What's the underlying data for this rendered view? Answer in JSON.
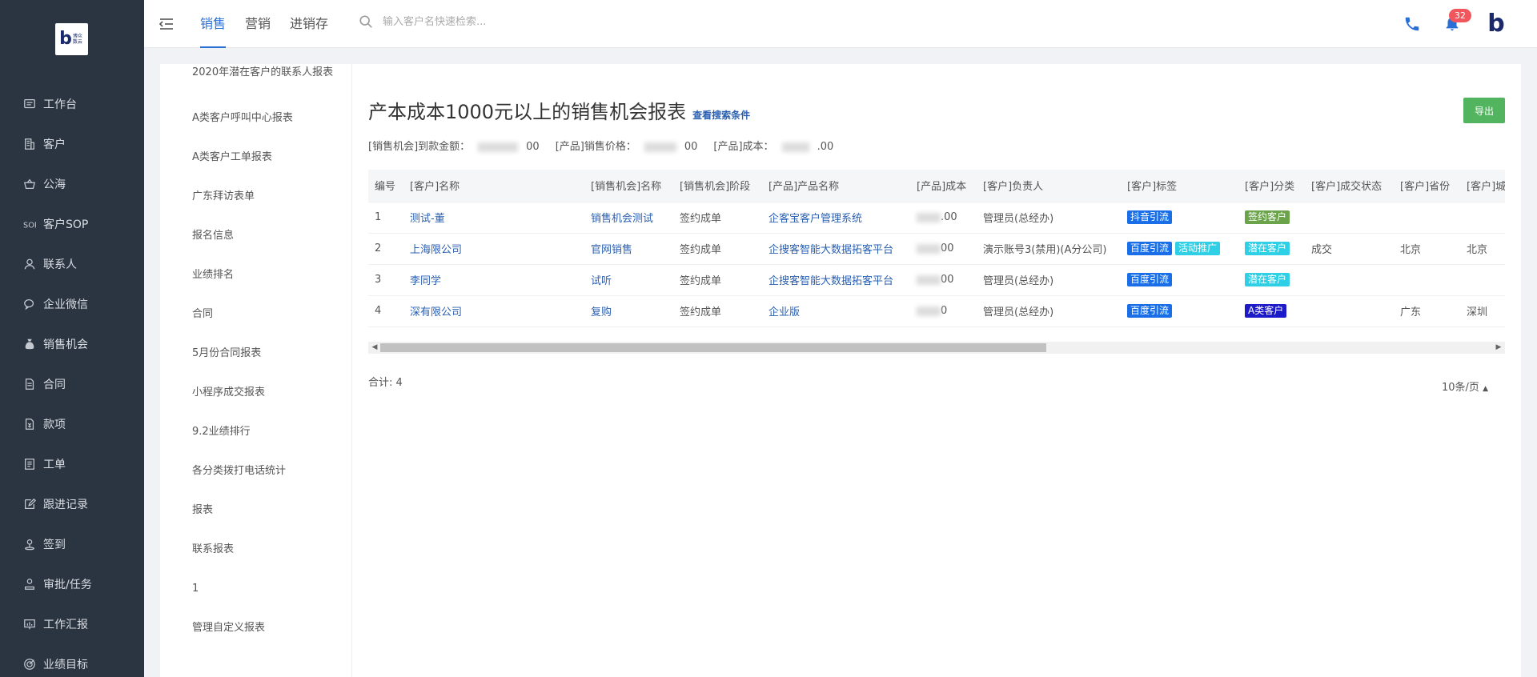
{
  "logo": {
    "text": "博众数云"
  },
  "sidebar": {
    "items": [
      {
        "label": "工作台",
        "icon": "dashboard-icon"
      },
      {
        "label": "客户",
        "icon": "building-icon"
      },
      {
        "label": "公海",
        "icon": "basket-icon"
      },
      {
        "label": "客户SOP",
        "icon": "sop-icon"
      },
      {
        "label": "联系人",
        "icon": "person-icon"
      },
      {
        "label": "企业微信",
        "icon": "wechat-icon"
      },
      {
        "label": "销售机会",
        "icon": "moneybag-icon"
      },
      {
        "label": "合同",
        "icon": "contract-icon"
      },
      {
        "label": "款项",
        "icon": "payment-icon"
      },
      {
        "label": "工单",
        "icon": "ticket-icon"
      },
      {
        "label": "跟进记录",
        "icon": "edit-icon"
      },
      {
        "label": "签到",
        "icon": "location-icon"
      },
      {
        "label": "审批/任务",
        "icon": "approval-icon"
      },
      {
        "label": "工作汇报",
        "icon": "report-icon"
      },
      {
        "label": "业绩目标",
        "icon": "target-icon"
      }
    ]
  },
  "topbar": {
    "tabs": [
      {
        "label": "销售",
        "active": true
      },
      {
        "label": "营销",
        "active": false
      },
      {
        "label": "进销存",
        "active": false
      }
    ],
    "search_placeholder": "输入客户名快速检索...",
    "notification_count": "32"
  },
  "reports": {
    "first": "2020年潜在客户的联系人报表",
    "items": [
      "A类客户呼叫中心报表",
      "A类客户工单报表",
      "广东拜访表单",
      "报名信息",
      "业绩排名",
      "合同",
      "5月份合同报表",
      "小程序成交报表",
      "9.2业绩排行",
      "各分类拨打电话统计",
      "报表",
      "联系报表",
      "1",
      "管理自定义报表"
    ]
  },
  "main": {
    "title": "产本成本1000元以上的销售机会报表",
    "sublink": "查看搜索条件",
    "export_label": "导出",
    "summary": {
      "amount_label": "[销售机会]到款金额：",
      "amount_tail": "00",
      "price_label": "[产品]销售价格：",
      "price_tail": "00",
      "cost_label": "[产品]成本：",
      "cost_tail": ".00"
    },
    "total_label": "合计:",
    "total_value": "4",
    "page_size": "10条/页"
  },
  "table": {
    "columns": [
      "编号",
      "[客户]名称",
      "[销售机会]名称",
      "[销售机会]阶段",
      "[产品]产品名称",
      "[产品]成本",
      "[客户]负责人",
      "[客户]标签",
      "[客户]分类",
      "[客户]成交状态",
      "[客户]省份",
      "[客户]城"
    ],
    "rows": [
      {
        "no": "1",
        "customer": "测试-董",
        "opp": "销售机会测试",
        "stage": "签约成单",
        "product": "企客宝客户管理系统",
        "cost": ".00",
        "owner": "管理员(总经办)",
        "tags": [
          {
            "t": "抖音引流",
            "c": "blue"
          }
        ],
        "category": {
          "t": "签约客户",
          "c": "green"
        },
        "deal": "",
        "province": "",
        "city": ""
      },
      {
        "no": "2",
        "customer": "上海限公司",
        "opp": "官网销售",
        "stage": "签约成单",
        "product": "企搜客智能大数据拓客平台",
        "cost": "00",
        "owner": "演示账号3(禁用)(A分公司)",
        "tags": [
          {
            "t": "百度引流",
            "c": "blue"
          },
          {
            "t": "活动推广",
            "c": "cyan"
          }
        ],
        "category": {
          "t": "潜在客户",
          "c": "cyan"
        },
        "deal": "成交",
        "province": "北京",
        "city": "北京"
      },
      {
        "no": "3",
        "customer": "李同学",
        "opp": "试听",
        "stage": "签约成单",
        "product": "企搜客智能大数据拓客平台",
        "cost": "00",
        "owner": "管理员(总经办)",
        "tags": [
          {
            "t": "百度引流",
            "c": "blue"
          }
        ],
        "category": {
          "t": "潜在客户",
          "c": "cyan"
        },
        "deal": "",
        "province": "",
        "city": ""
      },
      {
        "no": "4",
        "customer": "深有限公司",
        "opp": "复购",
        "stage": "签约成单",
        "product": "企业版",
        "cost": "0",
        "owner": "管理员(总经办)",
        "tags": [
          {
            "t": "百度引流",
            "c": "blue"
          }
        ],
        "category": {
          "t": "A类客户",
          "c": "navy"
        },
        "deal": "",
        "province": "广东",
        "city": "深圳"
      }
    ]
  }
}
